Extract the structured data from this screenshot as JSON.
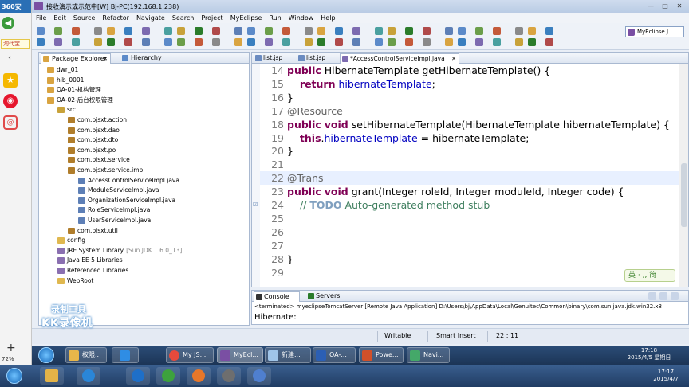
{
  "browser_strip": {
    "brand": "360安",
    "mall_label": "淘代宝",
    "zoom_pct": "72%"
  },
  "window": {
    "title": "接收演示或示范中[W]   BJ-PC(192.168.1.238)"
  },
  "menu": [
    "File",
    "Edit",
    "Source",
    "Refactor",
    "Navigate",
    "Search",
    "Project",
    "MyEclipse",
    "Run",
    "Window",
    "Help"
  ],
  "perspective": "MyEclipse J...",
  "explorer": {
    "tabs": [
      "Package Explorer",
      "Hierarchy"
    ],
    "tree": [
      {
        "label": "dwr_01",
        "indent": 0,
        "kind": "project"
      },
      {
        "label": "hib_0001",
        "indent": 0,
        "kind": "project"
      },
      {
        "label": "OA-01-机构管理",
        "indent": 0,
        "kind": "project"
      },
      {
        "label": "OA-02-后台权限管理",
        "indent": 0,
        "kind": "project"
      },
      {
        "label": "src",
        "indent": 1,
        "kind": "src"
      },
      {
        "label": "com.bjsxt.action",
        "indent": 2,
        "kind": "package"
      },
      {
        "label": "com.bjsxt.dao",
        "indent": 2,
        "kind": "package"
      },
      {
        "label": "com.bjsxt.dto",
        "indent": 2,
        "kind": "package"
      },
      {
        "label": "com.bjsxt.po",
        "indent": 2,
        "kind": "package"
      },
      {
        "label": "com.bjsxt.service",
        "indent": 2,
        "kind": "package"
      },
      {
        "label": "com.bjsxt.service.impl",
        "indent": 2,
        "kind": "package"
      },
      {
        "label": "AccessControlServiceImpl.java",
        "indent": 3,
        "kind": "file"
      },
      {
        "label": "ModuleServiceImpl.java",
        "indent": 3,
        "kind": "file"
      },
      {
        "label": "OrganizationServiceImpl.java",
        "indent": 3,
        "kind": "file"
      },
      {
        "label": "RoleServiceImpl.java",
        "indent": 3,
        "kind": "file"
      },
      {
        "label": "UserServiceImpl.java",
        "indent": 3,
        "kind": "file"
      },
      {
        "label": "com.bjsxt.util",
        "indent": 2,
        "kind": "package"
      },
      {
        "label": "config",
        "indent": 1,
        "kind": "folder"
      },
      {
        "label": "JRE System Library",
        "suffix": "[Sun JDK 1.6.0_13]",
        "indent": 1,
        "kind": "lib"
      },
      {
        "label": "Java EE 5 Libraries",
        "indent": 1,
        "kind": "lib"
      },
      {
        "label": "Referenced Libraries",
        "indent": 1,
        "kind": "lib"
      },
      {
        "label": "WebRoot",
        "indent": 1,
        "kind": "folder"
      }
    ]
  },
  "editor": {
    "tabs": [
      "list.jsp",
      "list.jsp",
      "*AccessControlServiceImpl.java"
    ],
    "lines": [
      {
        "n": "14",
        "code": "public HibernateTemplate getHibernateTemplate() {"
      },
      {
        "n": "15",
        "code": "    return hibernateTemplate;"
      },
      {
        "n": "16",
        "code": "}"
      },
      {
        "n": "17",
        "code": "@Resource"
      },
      {
        "n": "18",
        "code": "public void setHibernateTemplate(HibernateTemplate hibernateTemplate) {"
      },
      {
        "n": "19",
        "code": "    this.hibernateTemplate = hibernateTemplate;"
      },
      {
        "n": "20",
        "code": "}"
      },
      {
        "n": "21",
        "code": ""
      },
      {
        "n": "22",
        "code": "@Trans"
      },
      {
        "n": "23",
        "code": "public void grant(Integer roleId, Integer moduleId, Integer code) {"
      },
      {
        "n": "24",
        "code": "    // TODO Auto-generated method stub"
      },
      {
        "n": "25",
        "code": ""
      },
      {
        "n": "26",
        "code": ""
      },
      {
        "n": "27",
        "code": ""
      },
      {
        "n": "28",
        "code": "}"
      },
      {
        "n": "29",
        "code": ""
      }
    ],
    "ime": "英 · ,, 简"
  },
  "console": {
    "tabs": [
      "Console",
      "Servers"
    ],
    "terminated": "<terminated> myeclipseTomcatServer [Remote Java Application] D:\\Users\\bj\\AppData\\Local\\Genuitec\\Common\\binary\\com.sun.java.jdk.win32.x8",
    "output": "Hibernate:"
  },
  "status": {
    "writable": "Writable",
    "insert": "Smart Insert",
    "pos": "22 : 11"
  },
  "taskbar_inner": {
    "buttons": [
      "权限...",
      "",
      "My JS...",
      "MyEcl...",
      "新建...",
      "OA-...",
      "Powe...",
      "Navi..."
    ],
    "time": "17:18",
    "date": "2015/4/5 星期日"
  },
  "taskbar_outer": {
    "time": "17:17",
    "date": "2015/4/7"
  },
  "watermark": {
    "line1": "录制工具",
    "line2": "KK录像机"
  }
}
